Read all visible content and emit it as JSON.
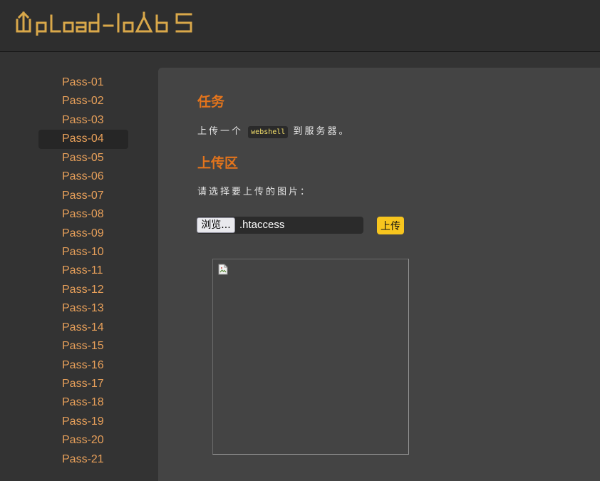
{
  "header": {
    "logo_text": "Upload-labs"
  },
  "sidebar": {
    "items": [
      {
        "label": "Pass-01"
      },
      {
        "label": "Pass-02"
      },
      {
        "label": "Pass-03"
      },
      {
        "label": "Pass-04"
      },
      {
        "label": "Pass-05"
      },
      {
        "label": "Pass-06"
      },
      {
        "label": "Pass-07"
      },
      {
        "label": "Pass-08"
      },
      {
        "label": "Pass-09"
      },
      {
        "label": "Pass-10"
      },
      {
        "label": "Pass-11"
      },
      {
        "label": "Pass-12"
      },
      {
        "label": "Pass-13"
      },
      {
        "label": "Pass-14"
      },
      {
        "label": "Pass-15"
      },
      {
        "label": "Pass-16"
      },
      {
        "label": "Pass-17"
      },
      {
        "label": "Pass-18"
      },
      {
        "label": "Pass-19"
      },
      {
        "label": "Pass-20"
      },
      {
        "label": "Pass-21"
      }
    ],
    "active_label": "Pass-04"
  },
  "main": {
    "task_title": "任务",
    "task_text_before": "上传一个",
    "task_code": "webshell",
    "task_text_after": "到服务器。",
    "upload_title": "上传区",
    "select_prompt": "请选择要上传的图片：",
    "browse_label": "浏览...",
    "file_name": ".htaccess",
    "submit_label": "上传",
    "preview_icon": "broken-image-icon"
  },
  "colors": {
    "accent_orange": "#e3741c",
    "nav_link": "#e8a05a",
    "logo_gold": "#d9a84a",
    "submit_yellow": "#f7c51e"
  }
}
